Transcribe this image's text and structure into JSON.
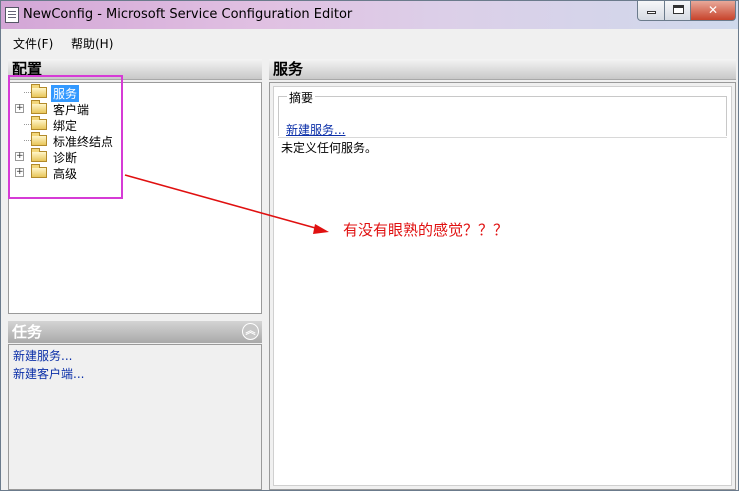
{
  "window": {
    "title": "NewConfig - Microsoft Service Configuration Editor",
    "close_glyph": "✕"
  },
  "menubar": {
    "items": [
      {
        "label": "文件(F)"
      },
      {
        "label": "帮助(H)"
      }
    ]
  },
  "config_panel": {
    "header": "配置",
    "tree": [
      {
        "label": "服务",
        "expandable": false,
        "selected": true
      },
      {
        "label": "客户端",
        "expandable": true,
        "selected": false
      },
      {
        "label": "绑定",
        "expandable": false,
        "selected": false
      },
      {
        "label": "标准终结点",
        "expandable": false,
        "selected": false
      },
      {
        "label": "诊断",
        "expandable": true,
        "selected": false
      },
      {
        "label": "高级",
        "expandable": true,
        "selected": false
      }
    ]
  },
  "tasks_panel": {
    "header": "任务",
    "collapse_glyph": "︽",
    "links": [
      {
        "label": "新建服务..."
      },
      {
        "label": "新建客户端..."
      }
    ]
  },
  "service_panel": {
    "header": "服务",
    "summary_legend": "摘要",
    "new_service_link": "新建服务...",
    "no_service_text": "未定义任何服务。"
  },
  "annotation": {
    "text": "有没有眼熟的感觉？？？",
    "color": "#e01010",
    "box_color": "#d63bd6"
  },
  "colors": {
    "link": "#0b2fa8",
    "selection": "#3399ff"
  }
}
